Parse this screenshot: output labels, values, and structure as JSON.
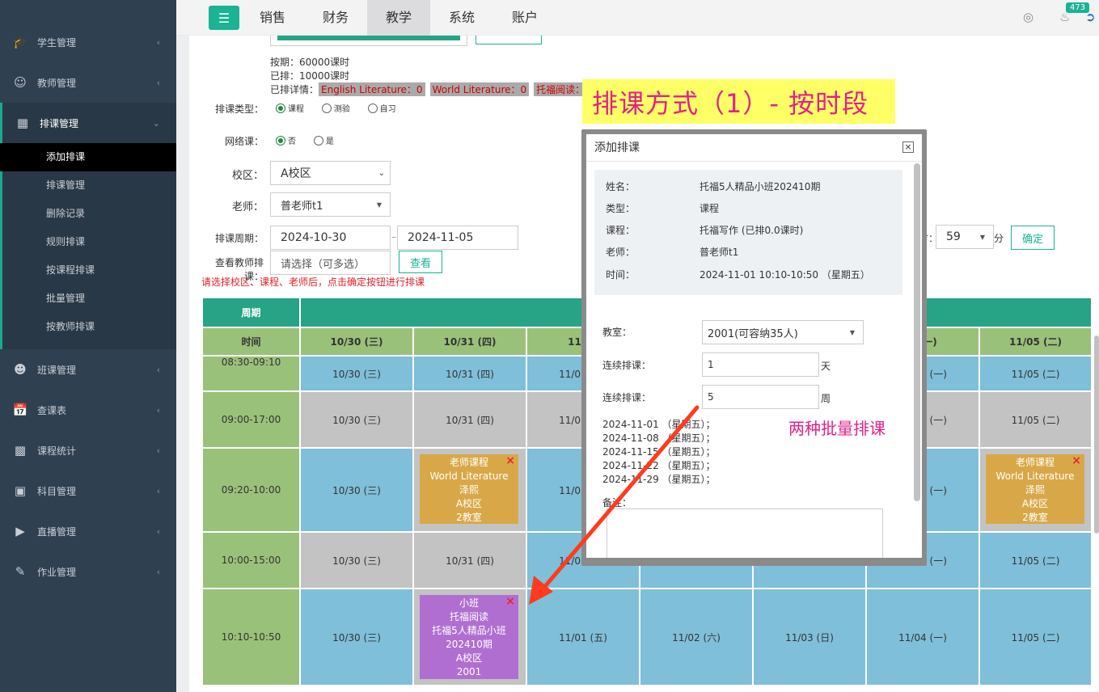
{
  "sidebar": {
    "items": [
      {
        "label": "学生管理",
        "icon": "graduation-cap-icon"
      },
      {
        "label": "教师管理",
        "icon": "user-icon"
      },
      {
        "label": "排课管理",
        "icon": "grid-icon"
      },
      {
        "label": "班课管理",
        "icon": "mask-icon"
      },
      {
        "label": "查课表",
        "icon": "calendar-icon"
      },
      {
        "label": "课程统计",
        "icon": "bar-chart-icon"
      },
      {
        "label": "科目管理",
        "icon": "book-icon"
      },
      {
        "label": "直播管理",
        "icon": "video-icon"
      },
      {
        "label": "作业管理",
        "icon": "user-edit-icon"
      }
    ],
    "sub_items": [
      "添加排课",
      "排课管理",
      "删除记录",
      "规则排课",
      "按课程排课",
      "批量管理",
      "按教师排课"
    ]
  },
  "topbar": {
    "nav": [
      "销售",
      "财务",
      "教学",
      "系统",
      "账户"
    ],
    "badge": "473"
  },
  "form": {
    "hours_plan": "按期：60000课时",
    "hours_scheduled": "已排：10000课时",
    "detail_label": "已排详情：",
    "detail_tags": [
      "English Literature：0",
      "World Literature：0",
      "托福阅读：10"
    ],
    "type_label": "排课类型：",
    "type_options": [
      "课程",
      "测验",
      "自习"
    ],
    "online_label": "网络课：",
    "online_options": [
      "否",
      "是"
    ],
    "campus_label": "校区：",
    "campus_value": "A校区",
    "teacher_label": "老师：",
    "teacher_value": "普老师t1",
    "period_label": "排课周期：",
    "period_start": "2024-10-30",
    "period_end": "2024-11-05",
    "view_label": "查看教师排课：",
    "view_placeholder": "请选择（可多选）",
    "view_button": "查看",
    "hint": "请选择校区、课程、老师后，点击确定按钮进行排课",
    "time_suffix_label": "时：",
    "minute_value": "59",
    "minute_unit": "分",
    "confirm_button": "确定"
  },
  "grid": {
    "week_header": "周期",
    "time_header": "时间",
    "days": [
      "10/30 (三)",
      "10/31 (四)",
      "11/01 (五)",
      "11/02 (六)",
      "11/03 (日)",
      "11/04 (一)",
      "11/05 (二)"
    ],
    "header_days": [
      "10/30 (三)",
      "10/31 (四)",
      "11/01",
      "",
      "",
      "4 (一)",
      "11/05 (二)"
    ],
    "times": [
      "08:30-09:10",
      "09:00-17:00",
      "09:20-10:00",
      "10:00-15:00",
      "10:10-10:50"
    ],
    "course_teacher": {
      "lines": [
        "老师课程",
        "World Literature",
        "泽熙",
        "A校区",
        "2教室"
      ]
    },
    "course_class": {
      "lines": [
        "小班",
        "托福阅读",
        "托福5人精品小班",
        "202410期",
        "A校区",
        "2001"
      ]
    },
    "close_glyph": "×"
  },
  "callout": "排课方式（1）- 按时段",
  "annotation": "两种批量排课",
  "modal": {
    "title": "添加排课",
    "close": "×",
    "info": [
      {
        "label": "姓名：",
        "value": "托福5人精品小班202410期"
      },
      {
        "label": "类型：",
        "value": "课程"
      },
      {
        "label": "课程：",
        "value": "托福写作 (已排0.0课时)"
      },
      {
        "label": "老师：",
        "value": "普老师t1"
      },
      {
        "label": "时间：",
        "value": "2024-11-01 10:10-10:50 （星期五）"
      }
    ],
    "room_label": "教室：",
    "room_value": "2001(可容纳35人)",
    "consec_days_label": "连续排课：",
    "consec_days_value": "1",
    "consec_days_unit": "天",
    "consec_weeks_label": "连续排课：",
    "consec_weeks_value": "5",
    "consec_weeks_unit": "周",
    "dates": [
      "2024-11-01 （星期五）；",
      "2024-11-08 （星期五）；",
      "2024-11-15 （星期五）；",
      "2024-11-22 （星期五）；",
      "2024-11-29 （星期五）；"
    ],
    "remark_label": "备注："
  },
  "colors": {
    "green": "#1ab394",
    "teal": "#27a386",
    "blue": "#7fbfd9",
    "gray": "#c3c3c3",
    "olive": "#9ac17a",
    "orange": "#d8a848",
    "purple": "#b06fd0"
  }
}
